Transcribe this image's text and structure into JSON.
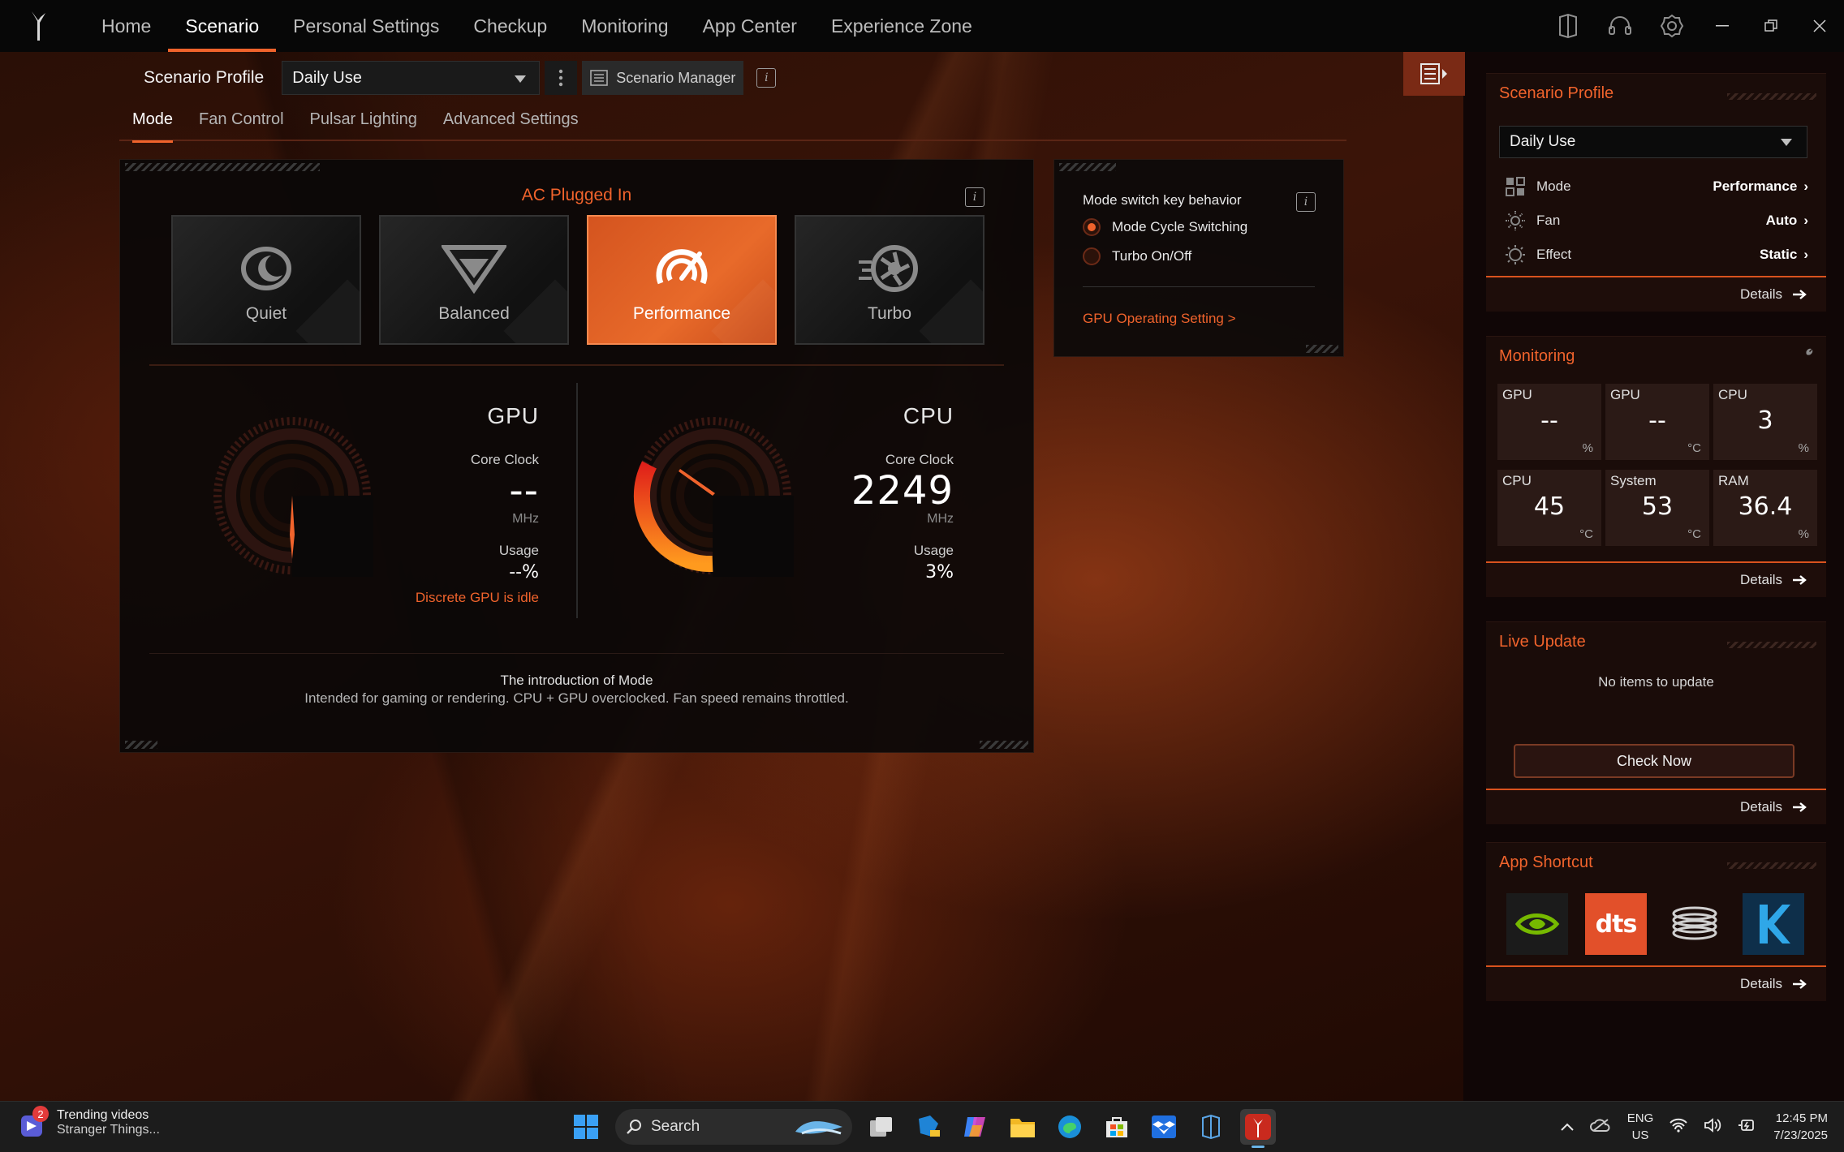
{
  "nav": {
    "items": [
      "Home",
      "Scenario",
      "Personal Settings",
      "Checkup",
      "Monitoring",
      "App Center",
      "Experience Zone"
    ],
    "active_index": 1
  },
  "profile_bar": {
    "label": "Scenario Profile",
    "selected": "Daily Use",
    "manager_label": "Scenario Manager"
  },
  "subtabs": [
    "Mode",
    "Fan Control",
    "Pulsar Lighting",
    "Advanced Settings"
  ],
  "mode_panel": {
    "power_state": "AC Plugged In",
    "modes": [
      "Quiet",
      "Balanced",
      "Performance",
      "Turbo"
    ],
    "active_mode_index": 2,
    "gpu": {
      "title": "GPU",
      "clock_label": "Core Clock",
      "clock_value": "--",
      "clock_unit": "MHz",
      "usage_label": "Usage",
      "usage_value": "--%",
      "usage_fraction": 0,
      "note": "Discrete GPU is idle"
    },
    "cpu": {
      "title": "CPU",
      "clock_label": "Core Clock",
      "clock_value": "2249",
      "clock_unit": "MHz",
      "usage_label": "Usage",
      "usage_value": "3%",
      "usage_fraction": 0.03
    },
    "intro_title": "The introduction of Mode",
    "intro_text": "Intended for gaming or rendering. CPU + GPU overclocked. Fan speed remains throttled."
  },
  "switch_panel": {
    "title": "Mode switch key behavior",
    "options": [
      "Mode Cycle Switching",
      "Turbo On/Off"
    ],
    "selected_index": 0,
    "gpu_link": "GPU Operating Setting >"
  },
  "sidebar": {
    "scenario_profile": {
      "title": "Scenario Profile",
      "selected": "Daily Use",
      "rows": [
        {
          "label": "Mode",
          "value": "Performance",
          "icon": "grid-icon"
        },
        {
          "label": "Fan",
          "value": "Auto",
          "icon": "fan-icon"
        },
        {
          "label": "Effect",
          "value": "Static",
          "icon": "sun-icon"
        }
      ],
      "details": "Details"
    },
    "monitoring": {
      "title": "Monitoring",
      "tiles": [
        {
          "label": "GPU",
          "value": "--",
          "unit": "%"
        },
        {
          "label": "GPU",
          "value": "--",
          "unit": "°C"
        },
        {
          "label": "CPU",
          "value": "3",
          "unit": "%"
        },
        {
          "label": "CPU",
          "value": "45",
          "unit": "°C"
        },
        {
          "label": "System",
          "value": "53",
          "unit": "°C"
        },
        {
          "label": "RAM",
          "value": "36.4",
          "unit": "%"
        }
      ],
      "details": "Details"
    },
    "live_update": {
      "title": "Live Update",
      "empty_text": "No items to update",
      "button": "Check Now",
      "details": "Details"
    },
    "app_shortcut": {
      "title": "App Shortcut",
      "apps": [
        "nvidia-icon",
        "dts-icon",
        "coil-icon",
        "k-icon"
      ],
      "dts_text": "dts",
      "details": "Details"
    }
  },
  "taskbar": {
    "news_badge": "2",
    "news_title": "Trending videos",
    "news_sub": "Stranger Things...",
    "search_label": "Search",
    "lang_top": "ENG",
    "lang_bottom": "US",
    "time": "12:45 PM",
    "date": "7/23/2025"
  },
  "colors": {
    "accent": "#f0632c",
    "panel": "#1a0c09"
  }
}
